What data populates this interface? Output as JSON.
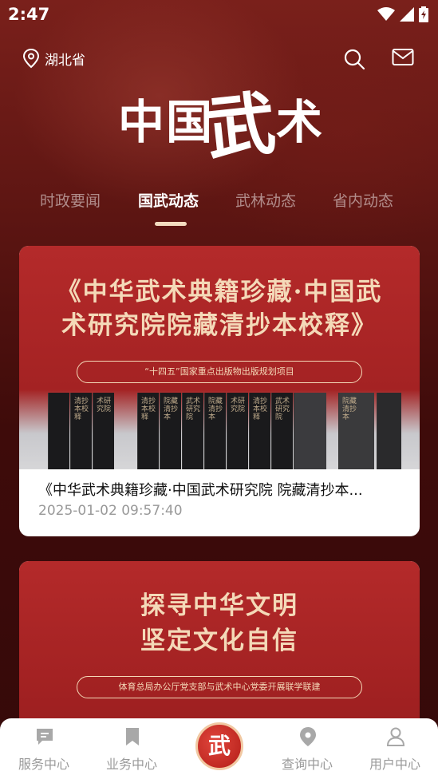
{
  "status_bar": {
    "time": "2:47"
  },
  "header": {
    "location": "湖北省",
    "search_icon": "search-icon",
    "mail_icon": "mail-icon"
  },
  "logo": {
    "part1": "中国",
    "part2": "武",
    "part3": "术"
  },
  "tabs": [
    {
      "label": "时政要闻",
      "active": false
    },
    {
      "label": "国武动态",
      "active": true
    },
    {
      "label": "武林动态",
      "active": false
    },
    {
      "label": "省内动态",
      "active": false
    }
  ],
  "articles": [
    {
      "banner_line1": "《中华武术典籍珍藏·中国武",
      "banner_line2": "术研究院院藏清抄本校释》",
      "banner_tag": "“十四五”国家重点出版物出版规划项目",
      "headline": "《中华武术典籍珍藏·中国武术研究院 院藏清抄本...",
      "date": "2025-01-02 09:57:40"
    },
    {
      "banner_line1": "探寻中华文明",
      "banner_line2": "坚定文化自信",
      "banner_tag": "体育总局办公厅党支部与武术中心党委开展联学联建"
    }
  ],
  "bottom_nav": {
    "items": [
      {
        "label": "服务中心",
        "icon": "chat-icon"
      },
      {
        "label": "业务中心",
        "icon": "bookmark-icon"
      },
      {
        "label": "查询中心",
        "icon": "location-pin-icon"
      },
      {
        "label": "用户中心",
        "icon": "user-icon"
      }
    ],
    "center_label": "武"
  },
  "colors": {
    "header_bg": "#6a1a16",
    "card_banner": "#a82424",
    "accent_gold": "#f4d9b8",
    "inactive_nav": "#9a9a9a"
  }
}
